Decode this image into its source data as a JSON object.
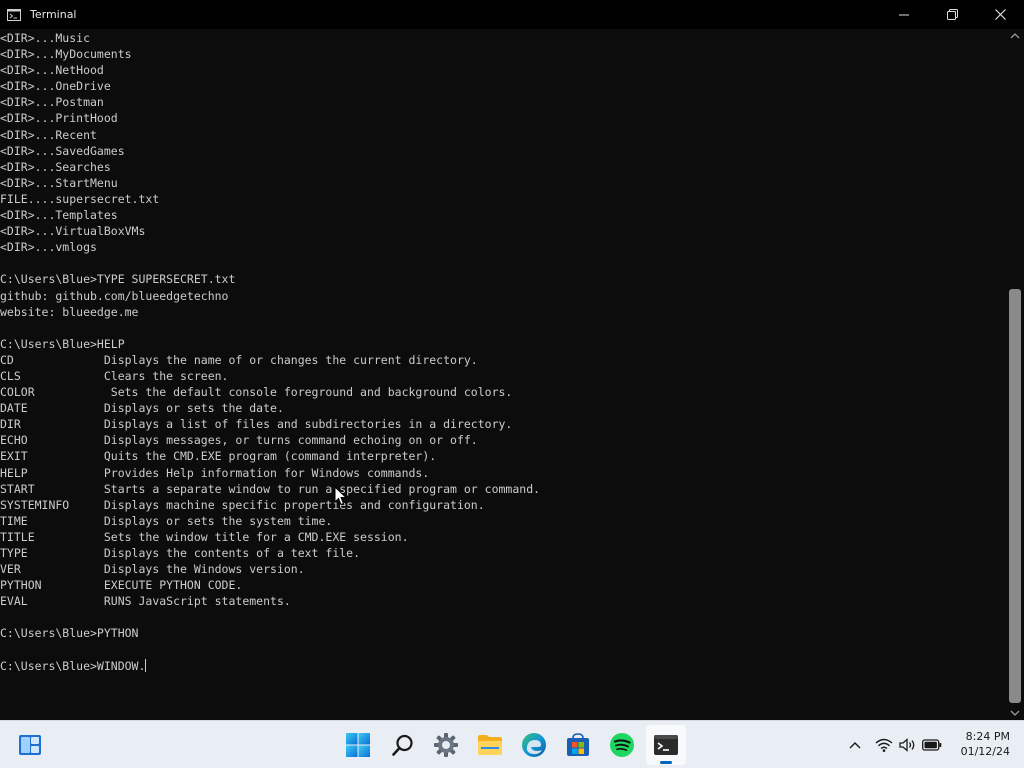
{
  "window": {
    "title": "Terminal",
    "icon": "terminal-icon",
    "controls": [
      "minimize-icon",
      "restore-icon",
      "close-icon"
    ]
  },
  "terminal": {
    "lines": [
      "<DIR>...Music",
      "<DIR>...MyDocuments",
      "<DIR>...NetHood",
      "<DIR>...OneDrive",
      "<DIR>...Postman",
      "<DIR>...PrintHood",
      "<DIR>...Recent",
      "<DIR>...SavedGames",
      "<DIR>...Searches",
      "<DIR>...StartMenu",
      "FILE....supersecret.txt",
      "<DIR>...Templates",
      "<DIR>...VirtualBoxVMs",
      "<DIR>...vmlogs",
      "",
      "C:\\Users\\Blue>TYPE SUPERSECRET.txt",
      "github: github.com/blueedgetechno",
      "website: blueedge.me",
      "",
      "C:\\Users\\Blue>HELP",
      "CD             Displays the name of or changes the current directory.",
      "CLS            Clears the screen.",
      "COLOR           Sets the default console foreground and background colors.",
      "DATE           Displays or sets the date.",
      "DIR            Displays a list of files and subdirectories in a directory.",
      "ECHO           Displays messages, or turns command echoing on or off.",
      "EXIT           Quits the CMD.EXE program (command interpreter).",
      "HELP           Provides Help information for Windows commands.",
      "START          Starts a separate window to run a specified program or command.",
      "SYSTEMINFO     Displays machine specific properties and configuration.",
      "TIME           Displays or sets the system time.",
      "TITLE          Sets the window title for a CMD.EXE session.",
      "TYPE           Displays the contents of a text file.",
      "VER            Displays the Windows version.",
      "PYTHON         EXECUTE PYTHON CODE.",
      "EVAL           RUNS JavaScript statements.",
      "",
      "C:\\Users\\Blue>PYTHON",
      ""
    ],
    "input_line": "C:\\Users\\Blue>WINDOW."
  },
  "taskbar": {
    "left_icon": "widgets-icon",
    "apps": [
      {
        "name": "start-icon"
      },
      {
        "name": "search-icon"
      },
      {
        "name": "settings-icon"
      },
      {
        "name": "file-explorer-icon"
      },
      {
        "name": "edge-icon"
      },
      {
        "name": "store-icon"
      },
      {
        "name": "spotify-icon"
      },
      {
        "name": "terminal-icon",
        "active": true
      }
    ],
    "tray_icons": [
      "chevron-up-icon",
      "wifi-icon",
      "volume-icon",
      "battery-icon"
    ],
    "clock": {
      "time": "8:24 PM",
      "date": "01/12/24"
    },
    "accent": "#0067c0"
  },
  "colors": {
    "terminal_bg": "#0c0c0c",
    "terminal_fg": "#cccccc",
    "taskbar_bg": "#e9eef4"
  }
}
